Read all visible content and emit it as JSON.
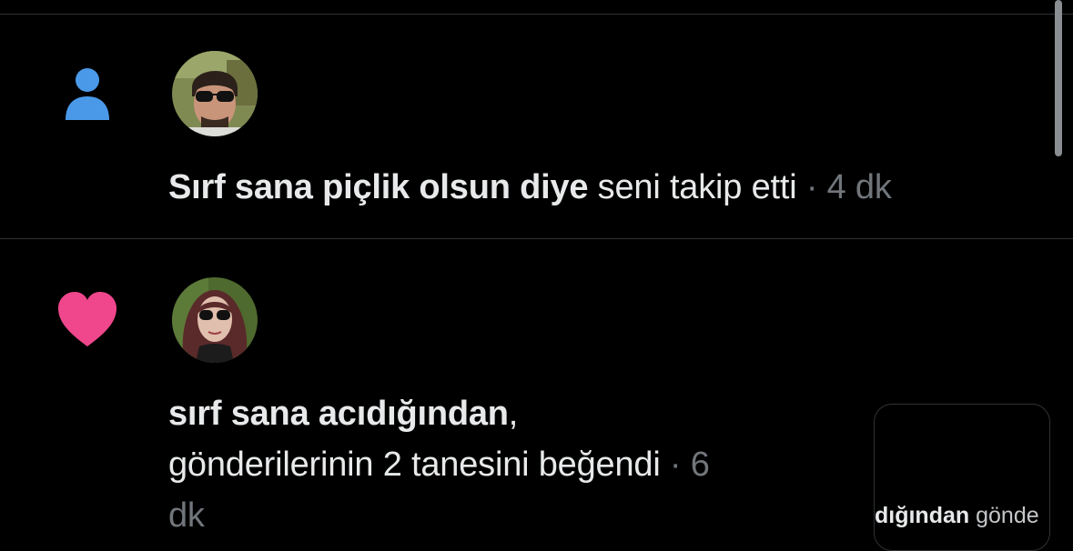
{
  "colors": {
    "background": "#000000",
    "divider": "#2f3336",
    "follow_icon": "#4a99e9",
    "like_icon": "#f0468c",
    "text_primary": "#e7e9ea",
    "text_secondary": "#71767b"
  },
  "notifications": [
    {
      "type_icon": "person-icon",
      "name": "Sırf sana piçlik olsun diye",
      "action": " seni takip etti",
      "time": " · 4 dk"
    },
    {
      "type_icon": "heart-icon",
      "name": "sırf sana acıdığından",
      "name_suffix": ",",
      "action_line": "gönderilerinin 2 tanesini beğendi",
      "time_part": " · 6",
      "time_cont": "dk",
      "preview": {
        "bold": "dığından",
        "rest": " gönde"
      }
    }
  ]
}
